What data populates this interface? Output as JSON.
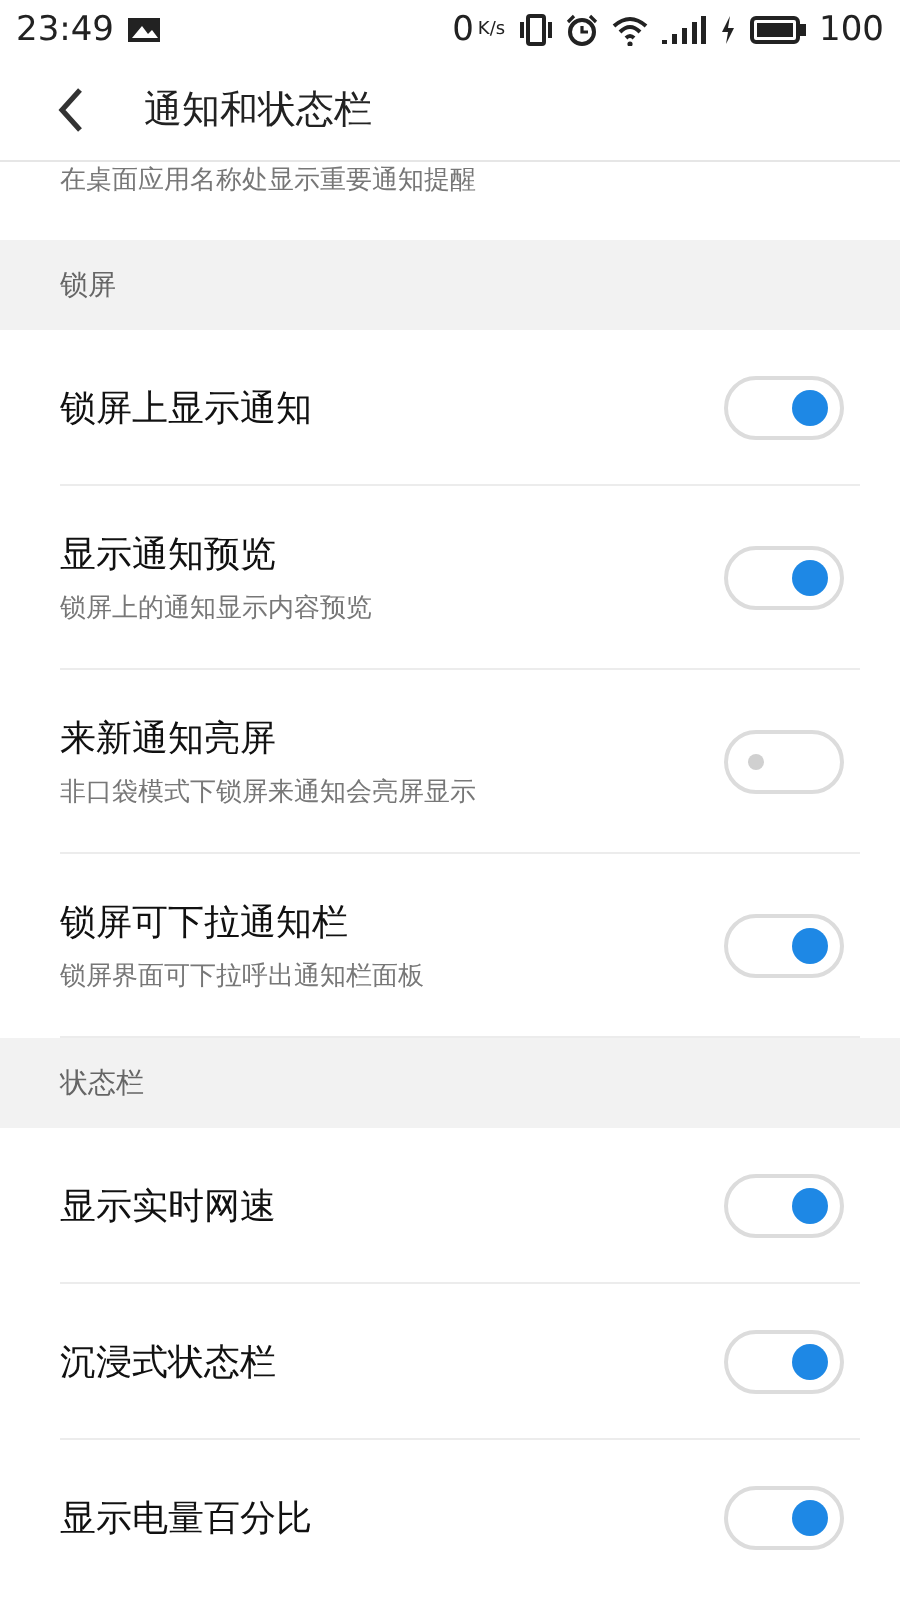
{
  "status_bar": {
    "time": "23:49",
    "net_speed": "0",
    "net_unit": "K/s",
    "battery": "100"
  },
  "header": {
    "title": "通知和状态栏"
  },
  "partial_item": {
    "subtitle": "在桌面应用名称处显示重要通知提醒"
  },
  "sections": [
    {
      "title": "锁屏",
      "items": [
        {
          "label": "锁屏上显示通知",
          "on": true
        },
        {
          "label": "显示通知预览",
          "subtitle": "锁屏上的通知显示内容预览",
          "on": true
        },
        {
          "label": "来新通知亮屏",
          "subtitle": "非口袋模式下锁屏来通知会亮屏显示",
          "on": false
        },
        {
          "label": "锁屏可下拉通知栏",
          "subtitle": "锁屏界面可下拉呼出通知栏面板",
          "on": true
        }
      ]
    },
    {
      "title": "状态栏",
      "items": [
        {
          "label": "显示实时网速",
          "on": true
        },
        {
          "label": "沉浸式状态栏",
          "on": true
        },
        {
          "label": "显示电量百分比",
          "on": true
        }
      ]
    }
  ]
}
